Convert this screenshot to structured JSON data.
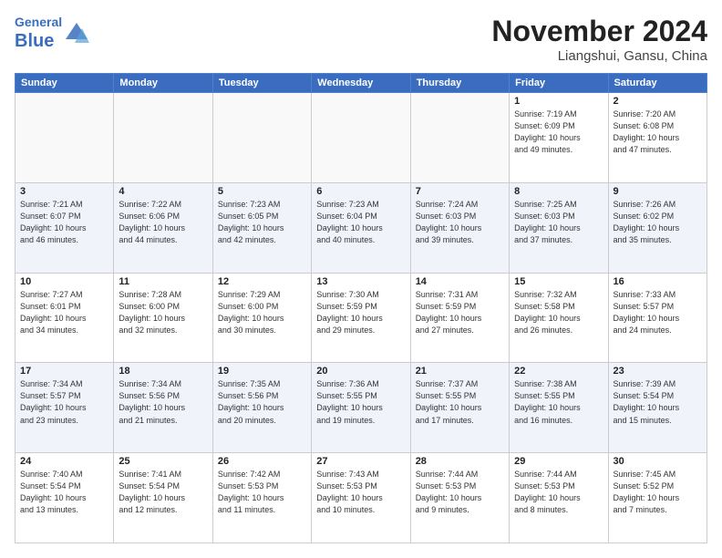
{
  "header": {
    "logo_general": "General",
    "logo_blue": "Blue",
    "month_title": "November 2024",
    "subtitle": "Liangshui, Gansu, China"
  },
  "weekdays": [
    "Sunday",
    "Monday",
    "Tuesday",
    "Wednesday",
    "Thursday",
    "Friday",
    "Saturday"
  ],
  "weeks": [
    [
      {
        "day": "",
        "info": ""
      },
      {
        "day": "",
        "info": ""
      },
      {
        "day": "",
        "info": ""
      },
      {
        "day": "",
        "info": ""
      },
      {
        "day": "",
        "info": ""
      },
      {
        "day": "1",
        "info": "Sunrise: 7:19 AM\nSunset: 6:09 PM\nDaylight: 10 hours\nand 49 minutes."
      },
      {
        "day": "2",
        "info": "Sunrise: 7:20 AM\nSunset: 6:08 PM\nDaylight: 10 hours\nand 47 minutes."
      }
    ],
    [
      {
        "day": "3",
        "info": "Sunrise: 7:21 AM\nSunset: 6:07 PM\nDaylight: 10 hours\nand 46 minutes."
      },
      {
        "day": "4",
        "info": "Sunrise: 7:22 AM\nSunset: 6:06 PM\nDaylight: 10 hours\nand 44 minutes."
      },
      {
        "day": "5",
        "info": "Sunrise: 7:23 AM\nSunset: 6:05 PM\nDaylight: 10 hours\nand 42 minutes."
      },
      {
        "day": "6",
        "info": "Sunrise: 7:23 AM\nSunset: 6:04 PM\nDaylight: 10 hours\nand 40 minutes."
      },
      {
        "day": "7",
        "info": "Sunrise: 7:24 AM\nSunset: 6:03 PM\nDaylight: 10 hours\nand 39 minutes."
      },
      {
        "day": "8",
        "info": "Sunrise: 7:25 AM\nSunset: 6:03 PM\nDaylight: 10 hours\nand 37 minutes."
      },
      {
        "day": "9",
        "info": "Sunrise: 7:26 AM\nSunset: 6:02 PM\nDaylight: 10 hours\nand 35 minutes."
      }
    ],
    [
      {
        "day": "10",
        "info": "Sunrise: 7:27 AM\nSunset: 6:01 PM\nDaylight: 10 hours\nand 34 minutes."
      },
      {
        "day": "11",
        "info": "Sunrise: 7:28 AM\nSunset: 6:00 PM\nDaylight: 10 hours\nand 32 minutes."
      },
      {
        "day": "12",
        "info": "Sunrise: 7:29 AM\nSunset: 6:00 PM\nDaylight: 10 hours\nand 30 minutes."
      },
      {
        "day": "13",
        "info": "Sunrise: 7:30 AM\nSunset: 5:59 PM\nDaylight: 10 hours\nand 29 minutes."
      },
      {
        "day": "14",
        "info": "Sunrise: 7:31 AM\nSunset: 5:59 PM\nDaylight: 10 hours\nand 27 minutes."
      },
      {
        "day": "15",
        "info": "Sunrise: 7:32 AM\nSunset: 5:58 PM\nDaylight: 10 hours\nand 26 minutes."
      },
      {
        "day": "16",
        "info": "Sunrise: 7:33 AM\nSunset: 5:57 PM\nDaylight: 10 hours\nand 24 minutes."
      }
    ],
    [
      {
        "day": "17",
        "info": "Sunrise: 7:34 AM\nSunset: 5:57 PM\nDaylight: 10 hours\nand 23 minutes."
      },
      {
        "day": "18",
        "info": "Sunrise: 7:34 AM\nSunset: 5:56 PM\nDaylight: 10 hours\nand 21 minutes."
      },
      {
        "day": "19",
        "info": "Sunrise: 7:35 AM\nSunset: 5:56 PM\nDaylight: 10 hours\nand 20 minutes."
      },
      {
        "day": "20",
        "info": "Sunrise: 7:36 AM\nSunset: 5:55 PM\nDaylight: 10 hours\nand 19 minutes."
      },
      {
        "day": "21",
        "info": "Sunrise: 7:37 AM\nSunset: 5:55 PM\nDaylight: 10 hours\nand 17 minutes."
      },
      {
        "day": "22",
        "info": "Sunrise: 7:38 AM\nSunset: 5:55 PM\nDaylight: 10 hours\nand 16 minutes."
      },
      {
        "day": "23",
        "info": "Sunrise: 7:39 AM\nSunset: 5:54 PM\nDaylight: 10 hours\nand 15 minutes."
      }
    ],
    [
      {
        "day": "24",
        "info": "Sunrise: 7:40 AM\nSunset: 5:54 PM\nDaylight: 10 hours\nand 13 minutes."
      },
      {
        "day": "25",
        "info": "Sunrise: 7:41 AM\nSunset: 5:54 PM\nDaylight: 10 hours\nand 12 minutes."
      },
      {
        "day": "26",
        "info": "Sunrise: 7:42 AM\nSunset: 5:53 PM\nDaylight: 10 hours\nand 11 minutes."
      },
      {
        "day": "27",
        "info": "Sunrise: 7:43 AM\nSunset: 5:53 PM\nDaylight: 10 hours\nand 10 minutes."
      },
      {
        "day": "28",
        "info": "Sunrise: 7:44 AM\nSunset: 5:53 PM\nDaylight: 10 hours\nand 9 minutes."
      },
      {
        "day": "29",
        "info": "Sunrise: 7:44 AM\nSunset: 5:53 PM\nDaylight: 10 hours\nand 8 minutes."
      },
      {
        "day": "30",
        "info": "Sunrise: 7:45 AM\nSunset: 5:52 PM\nDaylight: 10 hours\nand 7 minutes."
      }
    ]
  ]
}
